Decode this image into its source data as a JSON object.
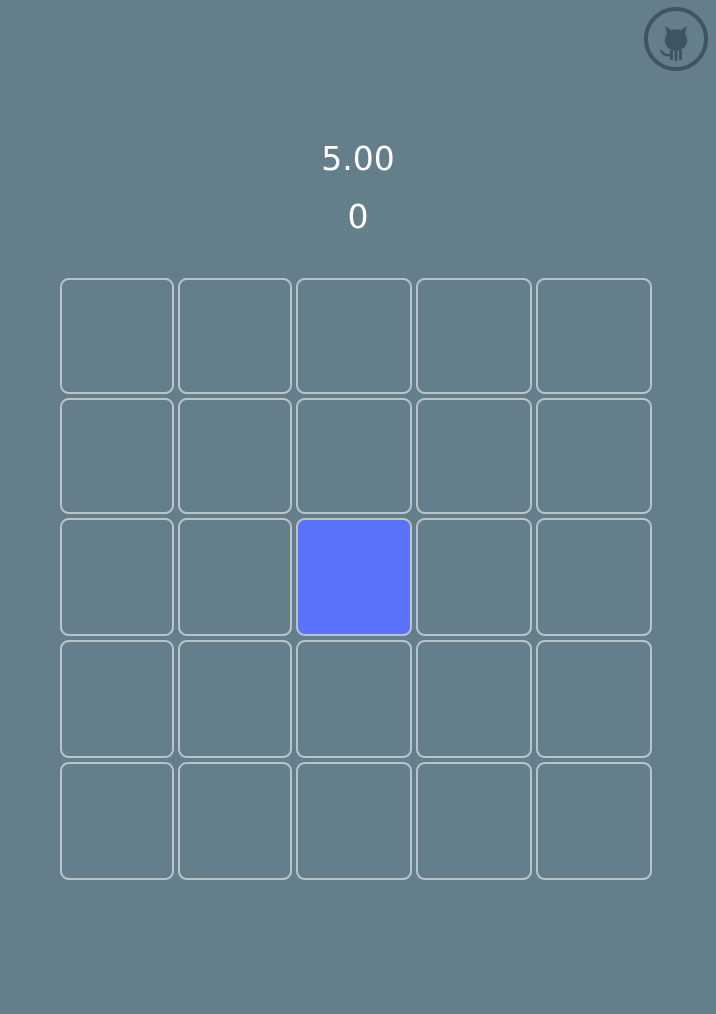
{
  "header": {
    "timer": "5.00",
    "score": "0"
  },
  "github": {
    "icon": "github-octocat-icon",
    "color": "#3e5663"
  },
  "board": {
    "rows": 5,
    "cols": 5,
    "active_cell": {
      "row": 2,
      "col": 2
    },
    "active_color": "#5a73fc",
    "cell_border_color": "#b9c3c8"
  },
  "colors": {
    "background": "#647f8b",
    "text": "#ffffff"
  }
}
